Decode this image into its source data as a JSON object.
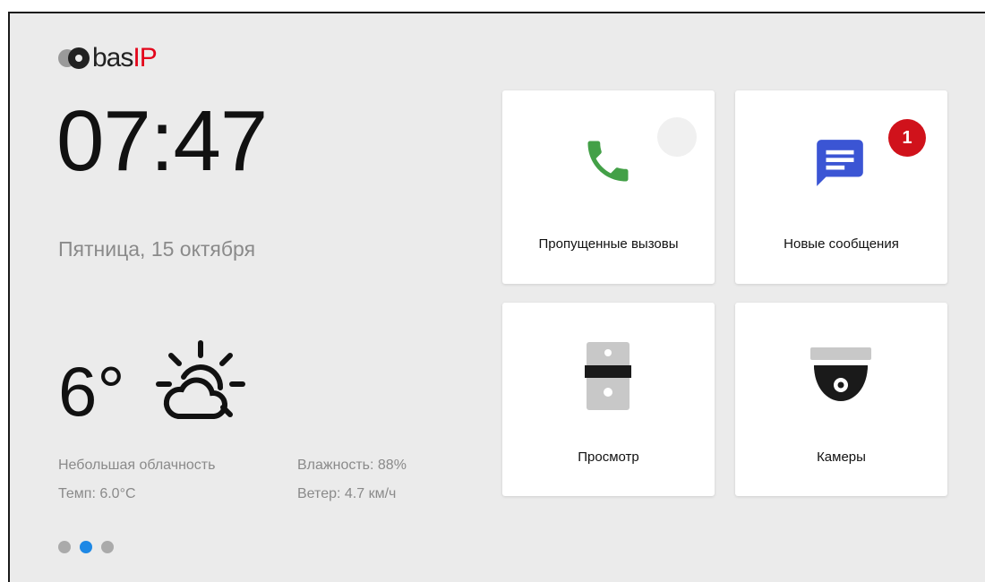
{
  "brand": {
    "part1": "bas",
    "part2": "IP",
    "accent": "#e3051b"
  },
  "clock": {
    "time": "07:47",
    "date": "Пятница, 15 октября"
  },
  "weather": {
    "temperature": "6°",
    "icon": "partly-cloudy-icon",
    "condition": "Небольшая облачность",
    "temp_line": "Темп: 6.0°C",
    "humidity": "Влажность: 88%",
    "wind": "Ветер: 4.7 км/ч"
  },
  "pager": {
    "pages": 3,
    "active_page": 2,
    "active_color": "#1e88e5"
  },
  "tiles": [
    {
      "label": "Пропущенные вызовы",
      "icon": "phone-icon",
      "color": "#43a047"
    },
    {
      "label": "Новые сообщения",
      "icon": "message-icon",
      "color": "#3b55d4",
      "badge": "1",
      "badge_color": "#d0121b"
    },
    {
      "label": "Просмотр",
      "icon": "door-panel-icon"
    },
    {
      "label": "Камеры",
      "icon": "camera-icon"
    }
  ]
}
